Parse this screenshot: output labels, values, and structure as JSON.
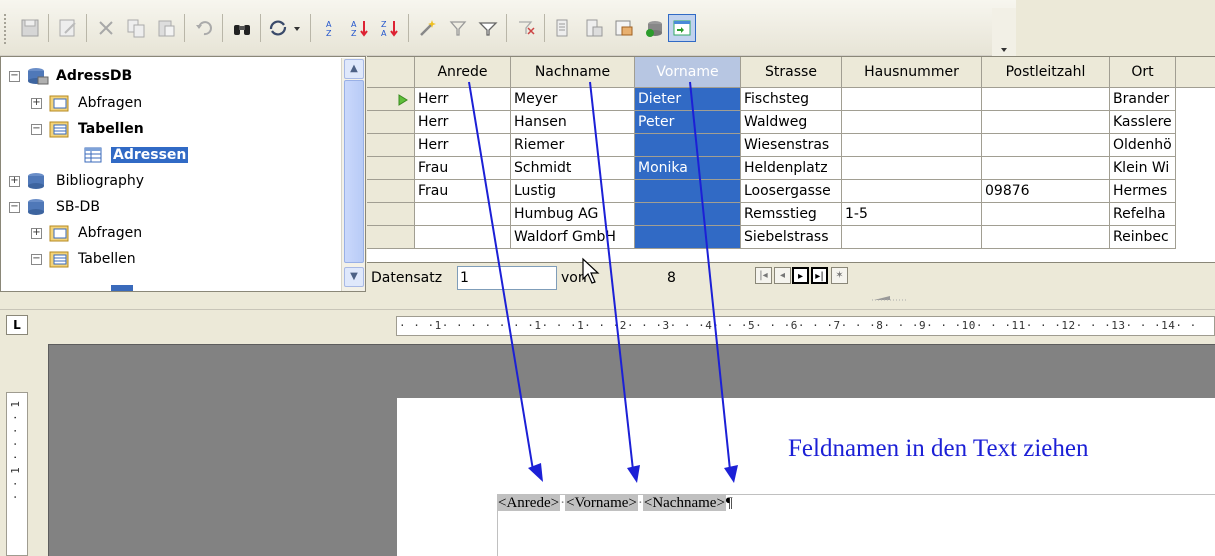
{
  "toolbar": {
    "icons": [
      "save-icon",
      "edit-icon",
      "cut-icon",
      "copy-icon",
      "paste-icon",
      "undo-icon",
      "find-icon",
      "refresh-icon",
      "sort-ascending-icon",
      "sort-ascending-az-icon",
      "sort-descending-za-icon",
      "autofilter-icon",
      "standard-filter-icon",
      "apply-filter-icon",
      "remove-filter-icon",
      "data-to-text-icon",
      "data-to-fields-icon",
      "mail-merge-icon",
      "data-source-icon",
      "explorer-toggle-icon"
    ]
  },
  "tree": {
    "items": [
      {
        "label": "AdressDB",
        "bold": true,
        "expanded": true
      },
      {
        "label": "Abfragen",
        "bold": false,
        "expanded": false
      },
      {
        "label": "Tabellen",
        "bold": true,
        "expanded": true
      },
      {
        "label": "Adressen",
        "bold": true,
        "selected": true
      },
      {
        "label": "Bibliography",
        "bold": false,
        "expanded": false
      },
      {
        "label": "SB-DB",
        "bold": false,
        "expanded": true
      },
      {
        "label": "Abfragen",
        "bold": false,
        "expanded": false
      },
      {
        "label": "Tabellen",
        "bold": false,
        "expanded": true
      }
    ]
  },
  "grid": {
    "columns": [
      "Anrede",
      "Nachname",
      "Vorname",
      "Strasse",
      "Hausnummer",
      "Postleitzahl",
      "Ort"
    ],
    "selected_column": "Vorname",
    "rows": [
      [
        "Herr",
        "Meyer",
        "Dieter",
        "Fischsteg",
        "",
        "",
        "Brander"
      ],
      [
        "Herr",
        "Hansen",
        "Peter",
        "Waldweg",
        "",
        "",
        "Kasslere"
      ],
      [
        "Herr",
        "Riemer",
        "",
        "Wiesenstras",
        "",
        "",
        "Oldenhö"
      ],
      [
        "Frau",
        "Schmidt",
        "Monika",
        "Heldenplatz",
        "",
        "",
        "Klein Wi"
      ],
      [
        "Frau",
        "Lustig",
        "",
        "Loosergasse",
        "",
        "09876",
        "Hermes"
      ],
      [
        "",
        "Humbug AG",
        "",
        "Remsstieg",
        "1-5",
        "",
        "Refelha"
      ],
      [
        "",
        "Waldorf GmbH",
        "",
        "Siebelstrass",
        "",
        "",
        "Reinbec"
      ]
    ]
  },
  "nav": {
    "record_label": "Datensatz",
    "record_value": "1",
    "of_label": "von",
    "total": "8",
    "buttons": [
      "first-record-icon",
      "previous-record-icon",
      "next-record-icon",
      "last-record-icon",
      "new-record-icon"
    ]
  },
  "ruler": {
    "tab_selector": "L",
    "horizontal_text": "· · ·1· · · · · · ·1· · ·1· · ·2· · ·3· · ·4· · ·5· · ·6· · ·7· · ·8· · ·9· · ·10· · ·11· · ·12· · ·13· · ·14· ·",
    "vertical_text": "· · 1 · · · · 1"
  },
  "document": {
    "fields": [
      "<Anrede>",
      "<Vorname>",
      "<Nachname>"
    ],
    "paragraph_mark": "¶",
    "annotation": "Feldnamen in den Text ziehen",
    "annotation_color": "#1c20d6"
  }
}
